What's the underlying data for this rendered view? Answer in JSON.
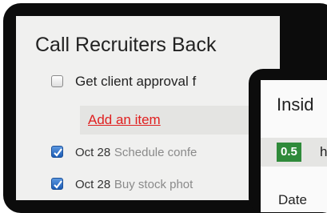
{
  "checklist": {
    "title": "Call Recruiters Back",
    "items": [
      {
        "label": "Get client approval f",
        "checked": false
      },
      {
        "date": "Oct 28",
        "task": "Schedule confe",
        "checked": true
      },
      {
        "date": "Oct 28",
        "task": "Buy stock phot",
        "checked": true
      }
    ],
    "add_item_label": "Add an item"
  },
  "inside_panel": {
    "title": "Insid",
    "hours_value": "0.5",
    "hours_unit": "h",
    "date_header": "Date"
  },
  "colors": {
    "link_red": "#e02020",
    "badge_green": "#2f8a3a",
    "checkbox_blue": "#1c5cb4"
  }
}
